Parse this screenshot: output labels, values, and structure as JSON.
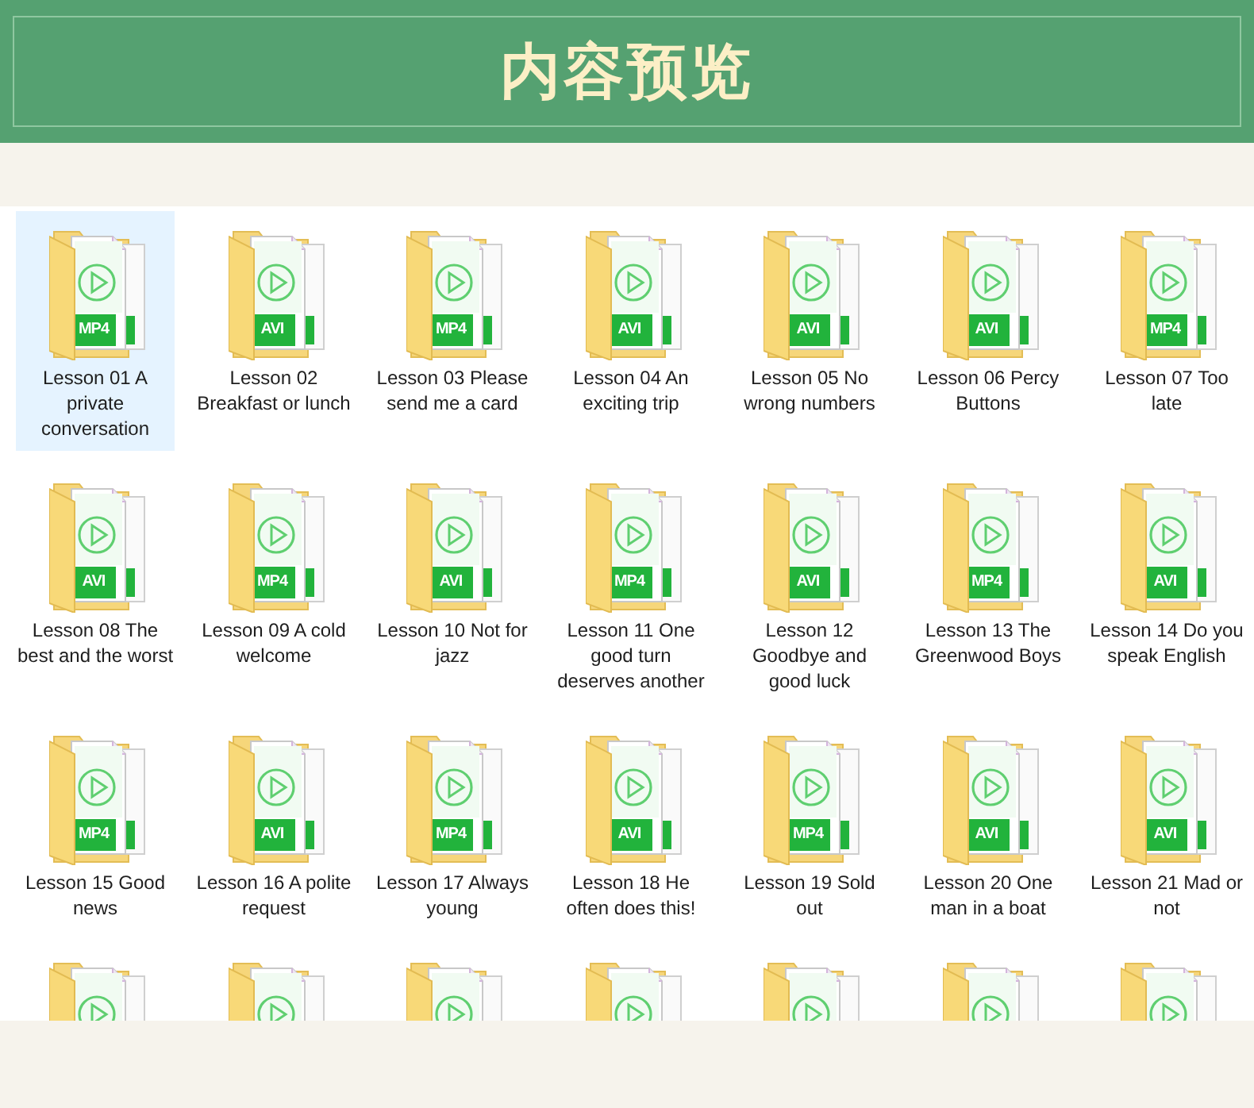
{
  "header": {
    "title": "内容预览"
  },
  "files": [
    {
      "label": "Lesson 01 A private conversation",
      "format": "MP4",
      "selected": true
    },
    {
      "label": "Lesson 02 Breakfast or lunch",
      "format": "AVI",
      "selected": false
    },
    {
      "label": "Lesson 03 Please send me a card",
      "format": "MP4",
      "selected": false
    },
    {
      "label": "Lesson 04 An exciting trip",
      "format": "AVI",
      "selected": false
    },
    {
      "label": "Lesson 05 No wrong numbers",
      "format": "AVI",
      "selected": false
    },
    {
      "label": "Lesson 06 Percy Buttons",
      "format": "AVI",
      "selected": false
    },
    {
      "label": "Lesson 07 Too late",
      "format": "MP4",
      "selected": false
    },
    {
      "label": "Lesson 08 The best and the worst",
      "format": "AVI",
      "selected": false
    },
    {
      "label": "Lesson 09 A cold welcome",
      "format": "MP4",
      "selected": false
    },
    {
      "label": "Lesson 10 Not for jazz",
      "format": "AVI",
      "selected": false
    },
    {
      "label": "Lesson 11 One good turn deserves another",
      "format": "MP4",
      "selected": false
    },
    {
      "label": "Lesson 12 Goodbye and good luck",
      "format": "AVI",
      "selected": false
    },
    {
      "label": "Lesson 13 The Greenwood Boys",
      "format": "MP4",
      "selected": false
    },
    {
      "label": "Lesson 14 Do you speak English",
      "format": "AVI",
      "selected": false
    },
    {
      "label": "Lesson 15 Good news",
      "format": "MP4",
      "selected": false
    },
    {
      "label": "Lesson 16 A polite request",
      "format": "AVI",
      "selected": false
    },
    {
      "label": "Lesson 17 Always young",
      "format": "MP4",
      "selected": false
    },
    {
      "label": "Lesson 18 He often does this!",
      "format": "AVI",
      "selected": false
    },
    {
      "label": "Lesson 19 Sold out",
      "format": "MP4",
      "selected": false
    },
    {
      "label": "Lesson 20 One man in a boat",
      "format": "AVI",
      "selected": false
    },
    {
      "label": "Lesson 21 Mad or not",
      "format": "AVI",
      "selected": false
    },
    {
      "selected": false
    },
    {
      "selected": false
    },
    {
      "selected": false
    },
    {
      "selected": false
    },
    {
      "selected": false
    },
    {
      "selected": false
    },
    {
      "selected": false
    }
  ]
}
